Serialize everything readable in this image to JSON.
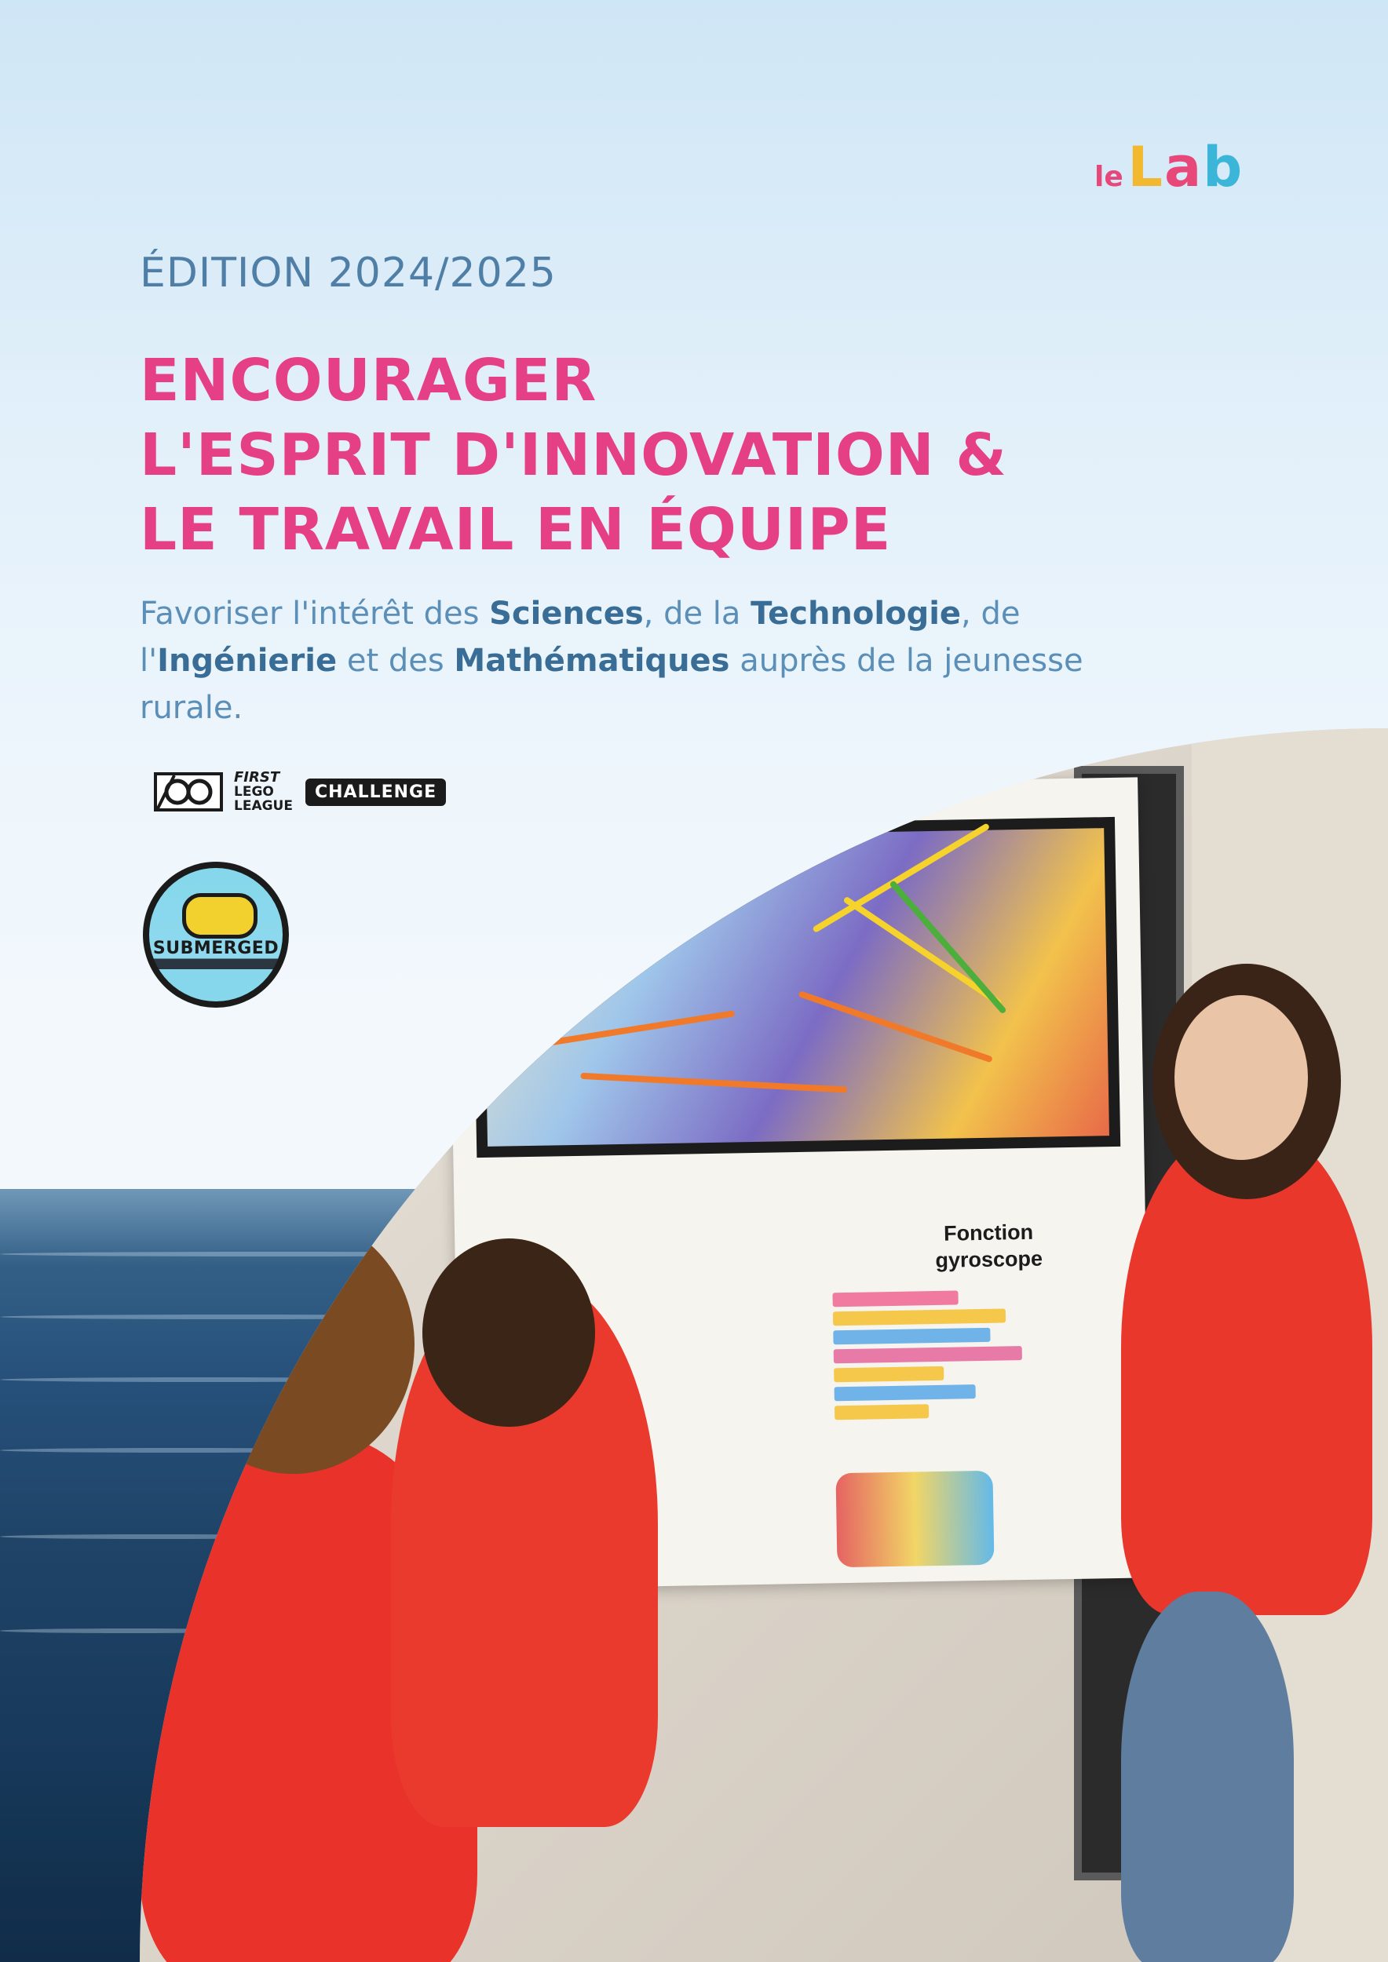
{
  "brand": {
    "logo_prefix": "le",
    "logo_main": "Lab"
  },
  "edition": "ÉDITION 2024/2025",
  "headline": {
    "line1": "ENCOURAGER",
    "line2": "L'ESPRIT D'INNOVATION &",
    "line3": "LE TRAVAIL EN ÉQUIPE"
  },
  "intro": {
    "t1": "Favoriser l'intérêt des ",
    "b1": "Sciences",
    "t2": ", de la ",
    "b2": "Technologie",
    "t3": ", de l'",
    "b3": "Ingénierie",
    "t4": " et des ",
    "b4": "Mathématiques",
    "t5": " auprès de la jeunesse rurale."
  },
  "fll_logo": {
    "first": "FIRST",
    "lego": "LEGO",
    "league": "LEAGUE",
    "challenge": "CHALLENGE"
  },
  "badge": {
    "label": "SUBMERGED"
  },
  "photo": {
    "poster_title": "Fonction gyroscope"
  },
  "colors": {
    "headline": "#e53f86",
    "edition": "#4f7fa6",
    "intro_text": "#5b8fb8",
    "intro_bold": "#3a6d96"
  }
}
